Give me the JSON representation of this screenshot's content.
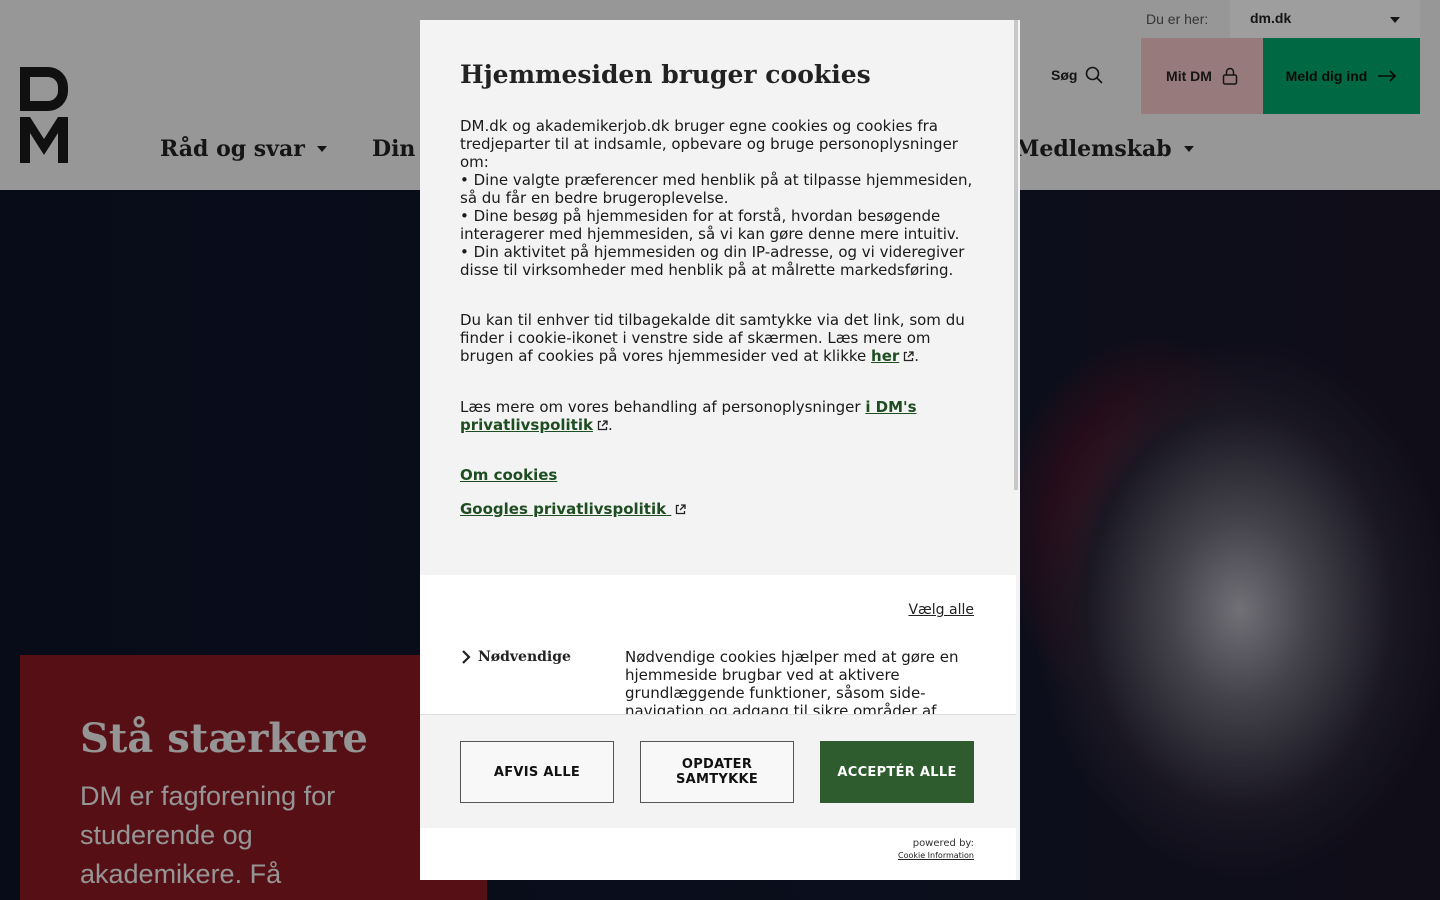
{
  "topbar": {
    "here_label": "Du er her:",
    "site_value": "dm.dk"
  },
  "header": {
    "search_label": "Søg",
    "mitdm_label": "Mit DM",
    "login_label": "Meld dig ind",
    "nav": [
      {
        "label": "Råd og svar"
      },
      {
        "label": "Din"
      },
      {
        "label": "Medlemskab"
      }
    ]
  },
  "hero": {
    "title": "Stå stærkere",
    "text": "DM er fagforening for studerende og akademikere. Få"
  },
  "cookie_dialog": {
    "title": "Hjemmesiden bruger cookies",
    "intro": "DM.dk og akademikerjob.dk bruger egne cookies og cookies fra tredjeparter til at indsamle, opbevare og bruge personoplysninger om:",
    "bullets": [
      "• Dine valgte præferencer med henblik på at tilpasse hjemmesiden, så du får en bedre brugeroplevelse.",
      "• Dine besøg på hjemmesiden for at forstå, hvordan besøgende interagerer med hjemmesiden, så vi kan gøre denne mere intuitiv.",
      "• Din aktivitet på hjemmesiden og din IP-adresse, og vi videregiver disse til virksomheder med henblik på at målrette markedsføring."
    ],
    "consent_text": "Du kan til enhver tid tilbagekalde dit samtykke via det link, som du finder i cookie-ikonet i venstre side af skærmen. Læs mere om brugen af cookies på vores hjemmesider ved at klikke",
    "consent_link": "her",
    "privacy_text": "Læs mere om vores behandling af personoplysninger",
    "privacy_link": "i DM's privatlivspolitik",
    "about_cookies_link": "Om cookies",
    "google_link": "Googles privatlivspolitik",
    "select_all": "Vælg alle",
    "necessary_label": "Nødvendige",
    "necessary_desc": "Nødvendige cookies hjælper med at gøre en hjemmeside brugbar ved at aktivere grundlæggende funktioner, såsom side-navigation og adgang til sikre områder af",
    "reject_all": "AFVIS ALLE",
    "update_consent": "OPDATER SAMTYKKE",
    "accept_all": "ACCEPTÉR ALLE",
    "powered_by": "powered by:",
    "powered_link": "Cookie Information"
  },
  "colors": {
    "accept_green": "#2e5c2e",
    "login_green": "#00a86b",
    "mitdm_pink": "#f3c6c8",
    "hero_card_red": "#8c1b22",
    "link_green": "#1f4d22"
  }
}
